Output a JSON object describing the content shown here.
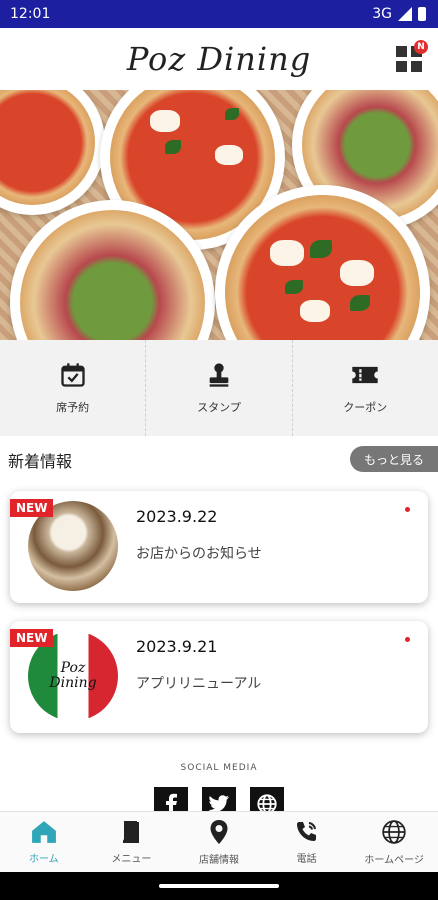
{
  "status_bar": {
    "time": "12:01",
    "network": "3G"
  },
  "header": {
    "logo": "Poz Dining",
    "menu_badge": "N"
  },
  "quick_nav": [
    {
      "label": "席予約",
      "icon": "calendar-check-icon"
    },
    {
      "label": "スタンプ",
      "icon": "stamp-icon"
    },
    {
      "label": "クーポン",
      "icon": "coupon-ticket-icon"
    }
  ],
  "news": {
    "title": "新着情報",
    "more_label": "もっと見る",
    "items": [
      {
        "tag": "NEW",
        "date": "2023.9.22",
        "text": "お店からのお知らせ"
      },
      {
        "tag": "NEW",
        "date": "2023.9.21",
        "text": "アプリリニューアル",
        "thumb_logo": "Poz Dining"
      }
    ]
  },
  "social": {
    "label": "SOCIAL MEDIA",
    "icons": [
      "facebook-icon",
      "twitter-icon",
      "globe-icon"
    ]
  },
  "tab_bar": [
    {
      "label": "ホーム",
      "icon": "home-icon",
      "active": true
    },
    {
      "label": "メニュー",
      "icon": "book-icon",
      "active": false
    },
    {
      "label": "店舗情報",
      "icon": "map-pin-icon",
      "active": false
    },
    {
      "label": "電話",
      "icon": "phone-icon",
      "active": false
    },
    {
      "label": "ホームページ",
      "icon": "globe-icon",
      "active": false
    }
  ],
  "colors": {
    "status_bar": "#1c1fa0",
    "accent": "#2fa6b8",
    "new_tag": "#e0242a"
  }
}
